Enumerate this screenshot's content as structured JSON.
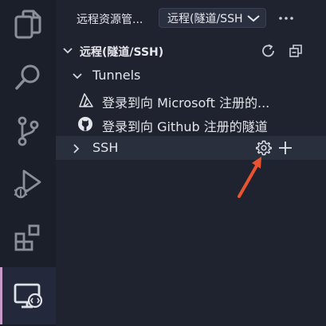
{
  "activity_bar": {
    "items": [
      {
        "icon": "explorer-icon"
      },
      {
        "icon": "search-icon"
      },
      {
        "icon": "source-control-icon"
      },
      {
        "icon": "run-debug-icon"
      },
      {
        "icon": "extensions-icon"
      },
      {
        "icon": "remote-explorer-icon",
        "active": true
      }
    ]
  },
  "header": {
    "title": "远程资源管...",
    "select_value": "远程(隧道/SSH",
    "more_icon": "ellipsis-icon"
  },
  "section": {
    "title": "远程(隧道/SSH)",
    "refresh_icon": "refresh-icon",
    "collapse_icon": "collapse-all-icon"
  },
  "tree": {
    "tunnels": {
      "label": "Tunnels",
      "items": [
        {
          "label": "登录到向 Microsoft 注册的...",
          "icon": "azure-icon"
        },
        {
          "label": "登录到向 Github 注册的隧道",
          "icon": "github-icon"
        }
      ]
    },
    "ssh": {
      "label": "SSH",
      "settings_icon": "gear-icon",
      "add_icon": "plus-icon"
    }
  },
  "colors": {
    "background": "#1f2330",
    "activity_bar": "#1b1f2a",
    "active_indicator": "#c79ac8",
    "annotation_arrow": "#e8542f"
  }
}
